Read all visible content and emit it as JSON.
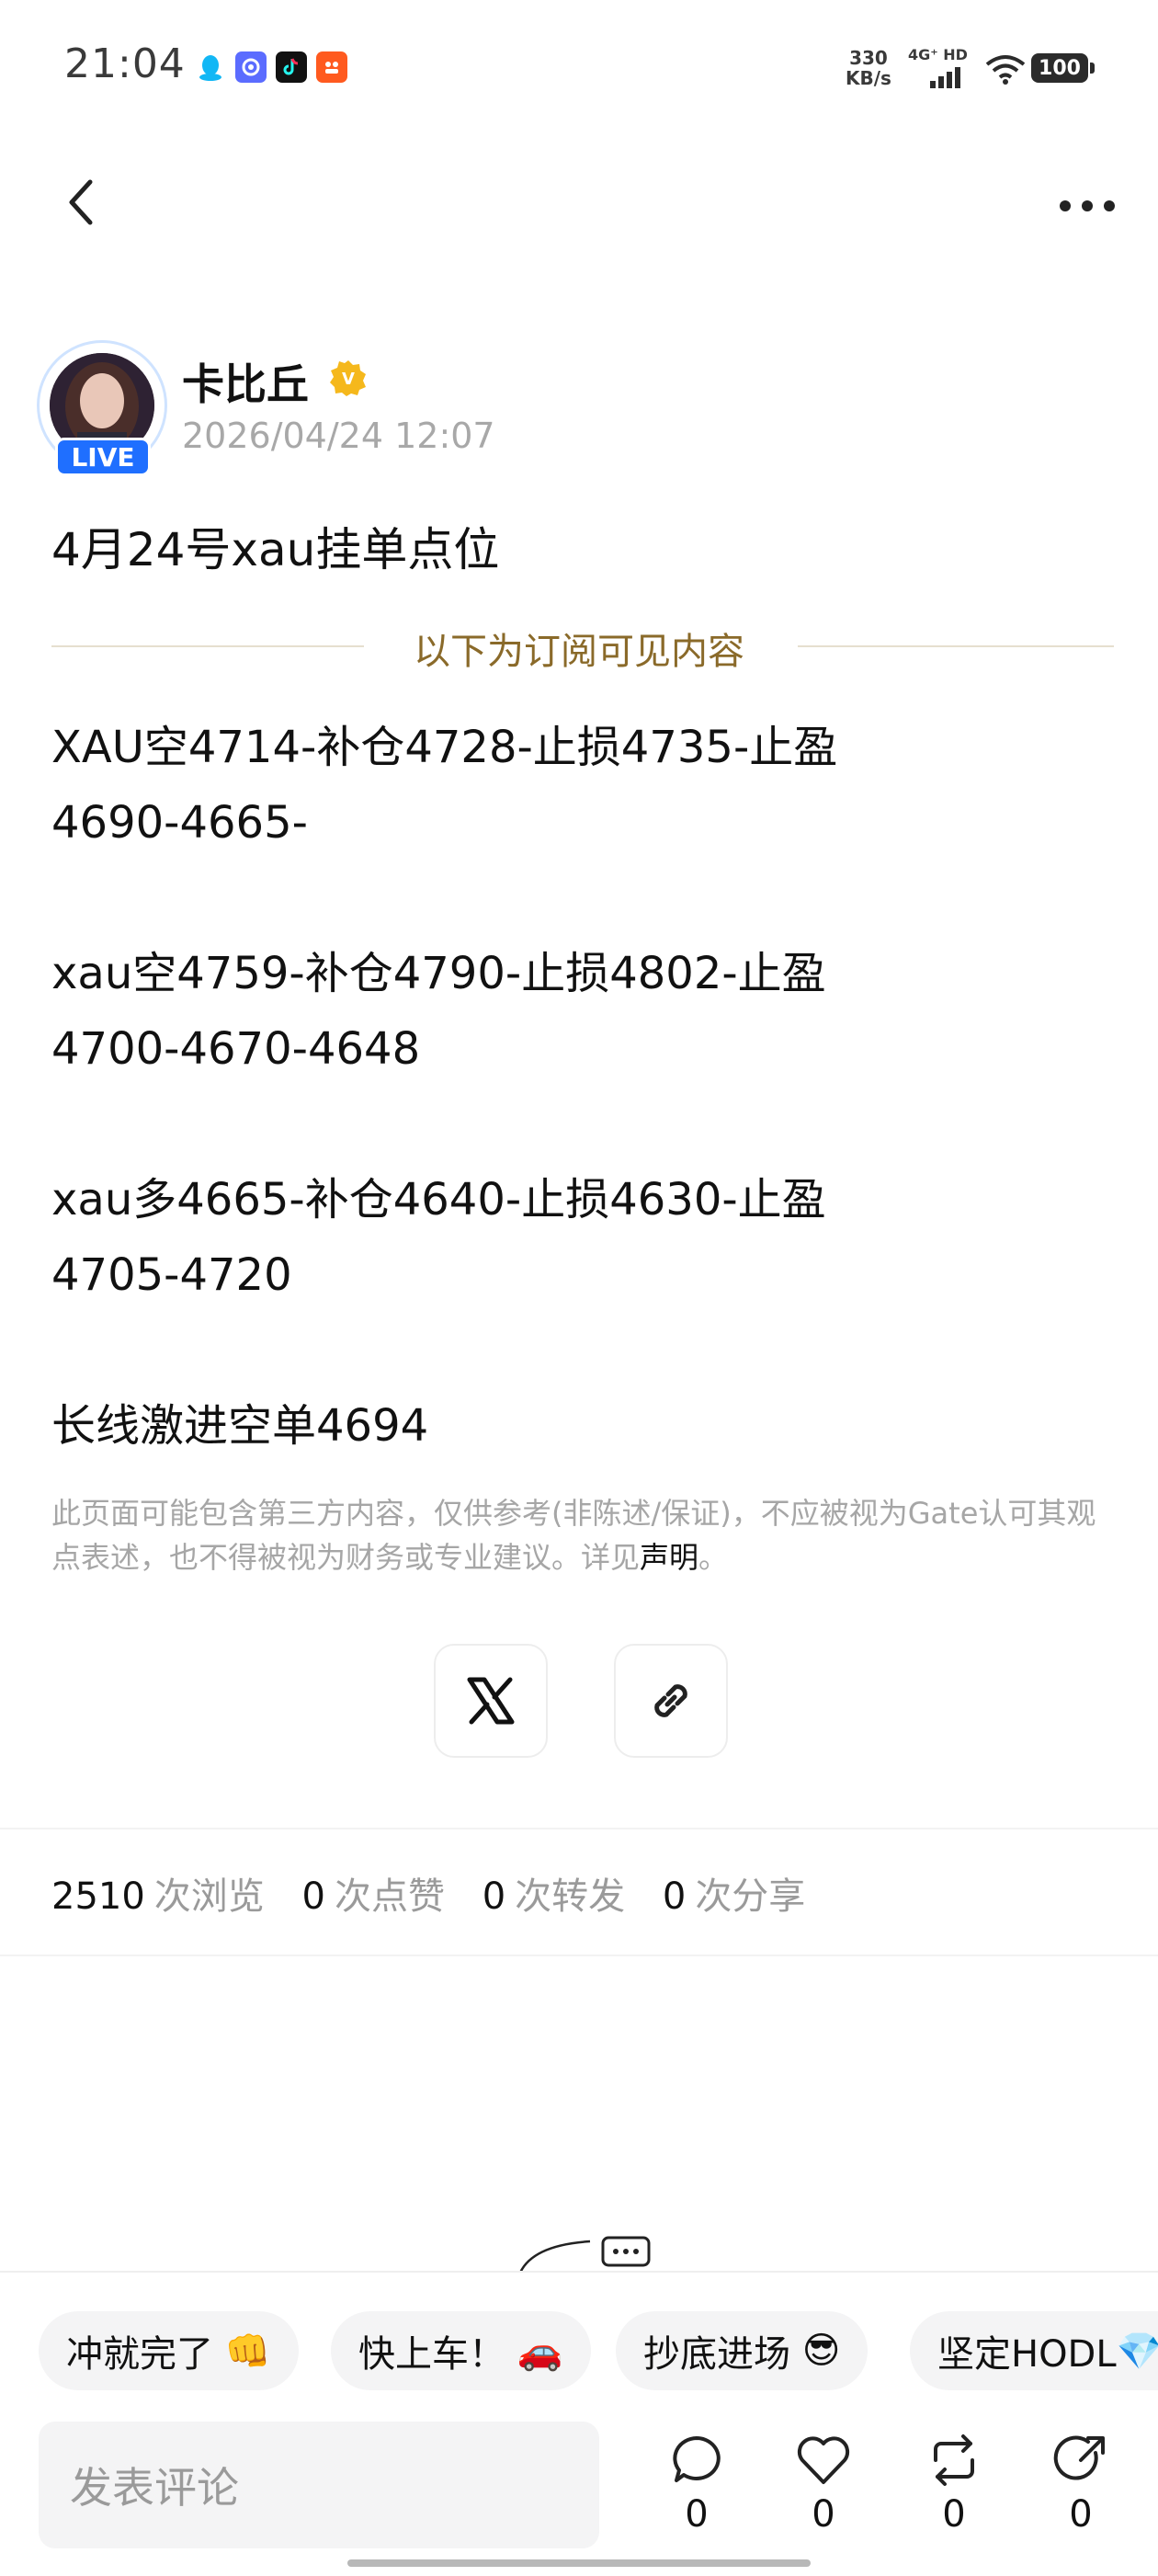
{
  "status_bar": {
    "time": "21:04",
    "net_speed_value": "330",
    "net_speed_unit": "KB/s",
    "network_type": "4G⁺ HD",
    "battery": "100"
  },
  "author": {
    "name": "卡比丘",
    "badge": "V",
    "time": "2026/04/24 12:07",
    "live_label": "LIVE"
  },
  "post": {
    "title": "4月24号xau挂单点位",
    "subscription_divider": "以下为订阅可见内容",
    "lines": [
      "XAU空4714-补仓4728-止损4735-止盈",
      "4690-4665-",
      "",
      "xau空4759-补仓4790-止损4802-止盈",
      "4700-4670-4648",
      "",
      "xau多4665-补仓4640-止损4630-止盈",
      "4705-4720",
      "",
      "长线激进空单4694"
    ],
    "disclaimer_text": "此页面可能包含第三方内容，仅供参考(非陈述/保证)，不应被视为Gate认可其观点表述，也不得被视为财务或专业建议。详见",
    "disclaimer_link": "声明",
    "disclaimer_end": "。"
  },
  "stats": {
    "views": "2510",
    "views_label": "次浏览",
    "likes": "0",
    "likes_label": "次点赞",
    "reposts": "0",
    "reposts_label": "次转发",
    "shares": "0",
    "shares_label": "次分享"
  },
  "quick_replies": [
    {
      "text": "冲就完了",
      "emoji": "👊"
    },
    {
      "text": "快上车！",
      "emoji": "🚗"
    },
    {
      "text": "抄底进场",
      "emoji": "😎"
    },
    {
      "text": "坚定HODL",
      "emoji": "💎"
    }
  ],
  "comment_placeholder": "发表评论",
  "actions": {
    "comment_count": "0",
    "like_count": "0",
    "repost_count": "0",
    "share_count": "0"
  },
  "colors": {
    "live_blue": "#1f6fff",
    "verified_gold": "#f5b81c",
    "divider_text": "#8a6a2a"
  }
}
